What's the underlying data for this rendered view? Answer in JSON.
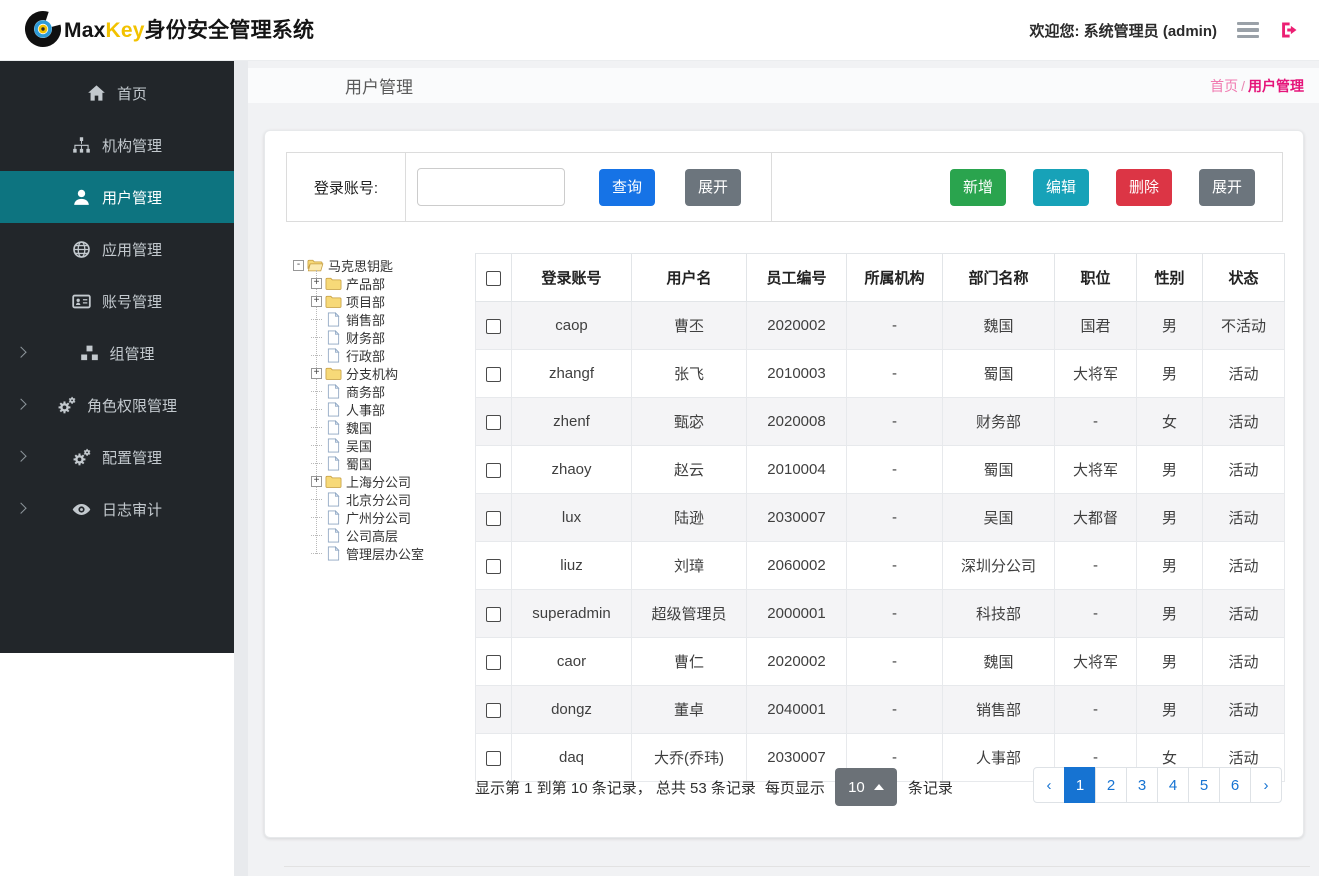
{
  "header": {
    "brand": {
      "max": "Max",
      "key": "Key",
      "suffix": "身份安全管理系统",
      "logo_icon": "maxkey-logo-icon"
    },
    "welcome_prefix": "欢迎您:",
    "welcome_user": "系统管理员 (admin)",
    "icons": [
      "menu-icon",
      "logout-icon"
    ]
  },
  "sidebar": {
    "items": [
      {
        "id": "home",
        "label": "首页",
        "icon": "home-icon",
        "active": false,
        "expandable": false
      },
      {
        "id": "org",
        "label": "机构管理",
        "icon": "sitemap-icon",
        "active": false,
        "expandable": false
      },
      {
        "id": "user",
        "label": "用户管理",
        "icon": "user-icon",
        "active": true,
        "expandable": false
      },
      {
        "id": "app",
        "label": "应用管理",
        "icon": "globe-icon",
        "active": false,
        "expandable": false
      },
      {
        "id": "account",
        "label": "账号管理",
        "icon": "id-card-icon",
        "active": false,
        "expandable": false
      },
      {
        "id": "group",
        "label": "组管理",
        "icon": "cubes-icon",
        "active": false,
        "expandable": true
      },
      {
        "id": "role",
        "label": "角色权限管理",
        "icon": "gears-icon",
        "active": false,
        "expandable": true
      },
      {
        "id": "config",
        "label": "配置管理",
        "icon": "gears-icon",
        "active": false,
        "expandable": true
      },
      {
        "id": "audit",
        "label": "日志审计",
        "icon": "eye-icon",
        "active": false,
        "expandable": true
      }
    ]
  },
  "page": {
    "title": "用户管理",
    "breadcrumb": {
      "home": "首页",
      "separator": "/",
      "current": "用户管理"
    }
  },
  "search": {
    "label": "登录账号:",
    "input_value": "",
    "buttons": {
      "query": "查询",
      "expand": "展开"
    }
  },
  "toolbar": {
    "buttons": {
      "add": "新增",
      "edit": "编辑",
      "delete": "删除",
      "expand": "展开"
    }
  },
  "tree": {
    "items": [
      {
        "label": "马克思钥匙",
        "level": 0,
        "node": "folder-open",
        "expand": "minus"
      },
      {
        "label": "产品部",
        "level": 1,
        "node": "folder",
        "expand": "plus"
      },
      {
        "label": "项目部",
        "level": 1,
        "node": "folder",
        "expand": "plus"
      },
      {
        "label": "销售部",
        "level": 1,
        "node": "file",
        "expand": "none"
      },
      {
        "label": "财务部",
        "level": 1,
        "node": "file",
        "expand": "none"
      },
      {
        "label": "行政部",
        "level": 1,
        "node": "file",
        "expand": "none"
      },
      {
        "label": "分支机构",
        "level": 1,
        "node": "folder",
        "expand": "plus"
      },
      {
        "label": "商务部",
        "level": 1,
        "node": "file",
        "expand": "none"
      },
      {
        "label": "人事部",
        "level": 1,
        "node": "file",
        "expand": "none"
      },
      {
        "label": "魏国",
        "level": 1,
        "node": "file",
        "expand": "none"
      },
      {
        "label": "吴国",
        "level": 1,
        "node": "file",
        "expand": "none"
      },
      {
        "label": "蜀国",
        "level": 1,
        "node": "file",
        "expand": "none"
      },
      {
        "label": "上海分公司",
        "level": 1,
        "node": "folder",
        "expand": "plus"
      },
      {
        "label": "北京分公司",
        "level": 1,
        "node": "file",
        "expand": "none"
      },
      {
        "label": "广州分公司",
        "level": 1,
        "node": "file",
        "expand": "none"
      },
      {
        "label": "公司高层",
        "level": 1,
        "node": "file",
        "expand": "none"
      },
      {
        "label": "管理层办公室",
        "level": 1,
        "node": "file",
        "expand": "none"
      }
    ]
  },
  "table": {
    "columns": [
      "登录账号",
      "用户名",
      "员工编号",
      "所属机构",
      "部门名称",
      "职位",
      "性别",
      "状态"
    ],
    "rows": [
      [
        "caop",
        "曹丕",
        "2020002",
        "-",
        "魏国",
        "国君",
        "男",
        "不活动"
      ],
      [
        "zhangf",
        "张飞",
        "2010003",
        "-",
        "蜀国",
        "大将军",
        "男",
        "活动"
      ],
      [
        "zhenf",
        "甄宓",
        "2020008",
        "-",
        "财务部",
        "-",
        "女",
        "活动"
      ],
      [
        "zhaoy",
        "赵云",
        "2010004",
        "-",
        "蜀国",
        "大将军",
        "男",
        "活动"
      ],
      [
        "lux",
        "陆逊",
        "2030007",
        "-",
        "吴国",
        "大都督",
        "男",
        "活动"
      ],
      [
        "liuz",
        "刘璋",
        "2060002",
        "-",
        "深圳分公司",
        "-",
        "男",
        "活动"
      ],
      [
        "superadmin",
        "超级管理员",
        "2000001",
        "-",
        "科技部",
        "-",
        "男",
        "活动"
      ],
      [
        "caor",
        "曹仁",
        "2020002",
        "-",
        "魏国",
        "大将军",
        "男",
        "活动"
      ],
      [
        "dongz",
        "董卓",
        "2040001",
        "-",
        "销售部",
        "-",
        "男",
        "活动"
      ],
      [
        "daq",
        "大乔(乔玮)",
        "2030007",
        "-",
        "人事部",
        "-",
        "女",
        "活动"
      ]
    ]
  },
  "pagination": {
    "info_prefix": "显示第 1 到第 10 条记录， 总共 53 条记录",
    "per_page_label": "每页显示",
    "page_size": "10",
    "info_suffix": "条记录",
    "prev": "‹",
    "next": "›",
    "pages": [
      "1",
      "2",
      "3",
      "4",
      "5",
      "6"
    ],
    "active_page": "1"
  },
  "colors": {
    "primary_blue": "#1673e6",
    "success_green": "#2aa44e",
    "info_teal": "#17a2b8",
    "danger_red": "#dc3545",
    "secondary_gray": "#6c757d",
    "sidebar_active_teal": "#0d7480",
    "brand_yellow": "#f2c200",
    "breadcrumb_pink": "#e5147a",
    "pagination_blue": "#1673d2"
  }
}
